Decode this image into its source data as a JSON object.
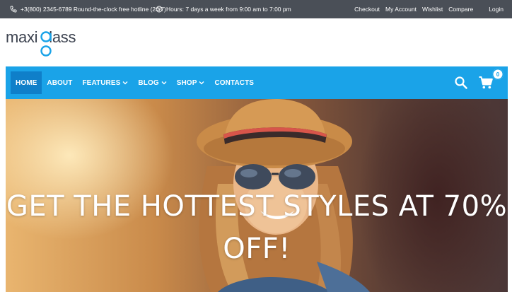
{
  "topbar": {
    "phone": "+3(800) 2345-6789 Round-the-clock free hotline (24/7)",
    "hours": "Hours: 7 days a week from 9:00 am to 7:00 pm",
    "links": [
      "Checkout",
      "My Account",
      "Wishlist",
      "Compare"
    ],
    "login": "Login"
  },
  "logo": {
    "left": "maxi",
    "right": "lass"
  },
  "nav": {
    "items": [
      {
        "label": "HOME",
        "active": true,
        "dropdown": false
      },
      {
        "label": "ABOUT",
        "active": false,
        "dropdown": false
      },
      {
        "label": "FEATURES",
        "active": false,
        "dropdown": true
      },
      {
        "label": "BLOG",
        "active": false,
        "dropdown": true
      },
      {
        "label": "SHOP",
        "active": false,
        "dropdown": true
      },
      {
        "label": "CONTACTS",
        "active": false,
        "dropdown": false
      }
    ],
    "cart_count": "0"
  },
  "hero": {
    "headline_line1": "GET THE HOTTEST STYLES AT 70%",
    "headline_line2": "OFF!"
  },
  "colors": {
    "topbar": "#4a4f57",
    "nav": "#1aa3e8",
    "nav_active": "#0f7fc9",
    "logo_accent": "#1aa3e8",
    "logo_text": "#3d4350"
  }
}
